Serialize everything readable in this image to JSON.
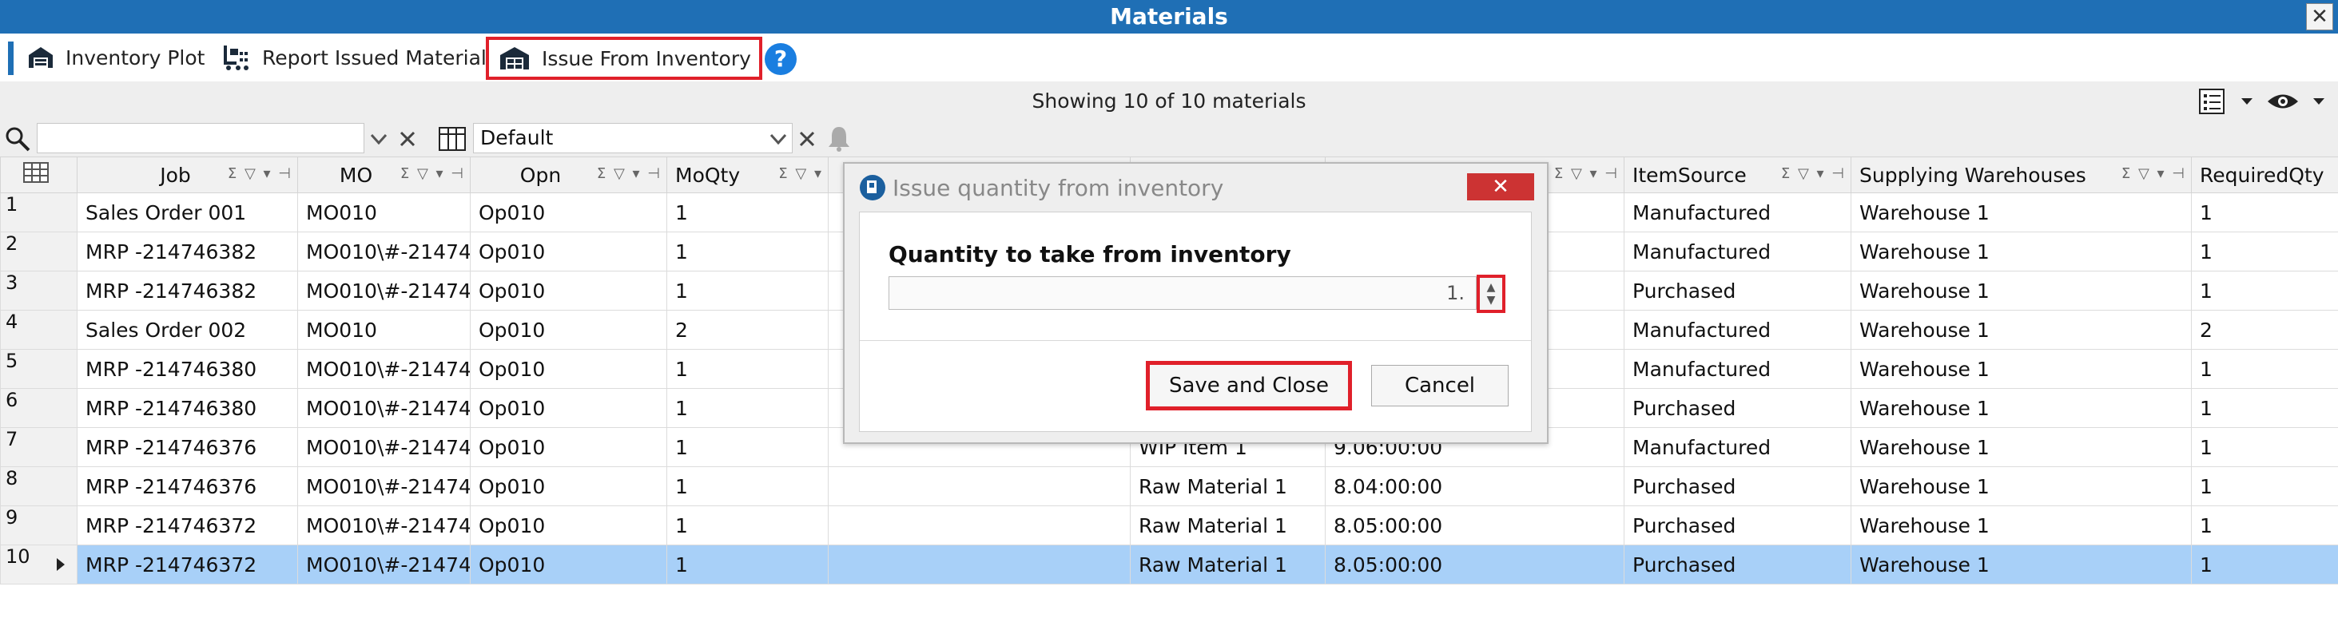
{
  "window": {
    "title": "Materials",
    "close_glyph": "✕"
  },
  "toolbar": {
    "inventory_plot_label": "Inventory Plot",
    "report_issued_label": "Report Issued Material",
    "issue_from_inventory_label": "Issue From Inventory",
    "help_glyph": "?"
  },
  "status": {
    "showing_text": "Showing 10 of 10 materials"
  },
  "filter": {
    "search_value": "",
    "layout_value": "Default"
  },
  "grid": {
    "columns": [
      "Job",
      "MO",
      "Opn",
      "MoQty",
      "",
      "",
      "",
      "ItemSource",
      "Supplying Warehouses",
      "RequiredQty"
    ],
    "rows": [
      {
        "num": "1",
        "job": "Sales Order 001",
        "mo": "MO010",
        "opn": "Op010",
        "moqty": "1",
        "c5": "",
        "c6": "",
        "c7": "",
        "source": "Manufactured",
        "warehouse": "Warehouse 1",
        "req": "1"
      },
      {
        "num": "2",
        "job": "MRP -214746382",
        "mo": "MO010\\#-21474",
        "opn": "Op010",
        "moqty": "1",
        "c5": "",
        "c6": "",
        "c7": "",
        "source": "Manufactured",
        "warehouse": "Warehouse 1",
        "req": "1"
      },
      {
        "num": "3",
        "job": "MRP -214746382",
        "mo": "MO010\\#-21474",
        "opn": "Op010",
        "moqty": "1",
        "c5": "",
        "c6": "",
        "c7": "",
        "source": "Purchased",
        "warehouse": "Warehouse 1",
        "req": "1"
      },
      {
        "num": "4",
        "job": "Sales Order 002",
        "mo": "MO010",
        "opn": "Op010",
        "moqty": "2",
        "c5": "",
        "c6": "",
        "c7": "",
        "source": "Manufactured",
        "warehouse": "Warehouse 1",
        "req": "2"
      },
      {
        "num": "5",
        "job": "MRP -214746380",
        "mo": "MO010\\#-21474",
        "opn": "Op010",
        "moqty": "1",
        "c5": "",
        "c6": "",
        "c7": "",
        "source": "Manufactured",
        "warehouse": "Warehouse 1",
        "req": "1"
      },
      {
        "num": "6",
        "job": "MRP -214746380",
        "mo": "MO010\\#-21474",
        "opn": "Op010",
        "moqty": "1",
        "c5": "",
        "c6": "",
        "c7": "",
        "source": "Purchased",
        "warehouse": "Warehouse 1",
        "req": "1"
      },
      {
        "num": "7",
        "job": "MRP -214746376",
        "mo": "MO010\\#-21474",
        "opn": "Op010",
        "moqty": "1",
        "c5": "",
        "c6": "WIP Item 1",
        "c7": "9.06:00:00",
        "source": "Manufactured",
        "warehouse": "Warehouse 1",
        "req": "1"
      },
      {
        "num": "8",
        "job": "MRP -214746376",
        "mo": "MO010\\#-21474",
        "opn": "Op010",
        "moqty": "1",
        "c5": "",
        "c6": "Raw Material 1",
        "c7": "8.04:00:00",
        "source": "Purchased",
        "warehouse": "Warehouse 1",
        "req": "1"
      },
      {
        "num": "9",
        "job": "MRP -214746372",
        "mo": "MO010\\#-21474",
        "opn": "Op010",
        "moqty": "1",
        "c5": "",
        "c6": "Raw Material 1",
        "c7": "8.05:00:00",
        "source": "Purchased",
        "warehouse": "Warehouse 1",
        "req": "1"
      },
      {
        "num": "10",
        "job": "MRP -214746372",
        "mo": "MO010\\#-21474",
        "opn": "Op010",
        "moqty": "1",
        "c5": "",
        "c6": "Raw Material 1",
        "c7": "8.05:00:00",
        "source": "Purchased",
        "warehouse": "Warehouse 1",
        "req": "1"
      }
    ],
    "selected_row": "10"
  },
  "dialog": {
    "title": "Issue quantity from inventory",
    "close_glyph": "✕",
    "quantity_label": "Quantity to take from inventory",
    "quantity_value": "1.",
    "save_label": "Save and Close",
    "cancel_label": "Cancel"
  },
  "colors": {
    "title_bar": "#1f6fb5",
    "selected_row": "#a8d0f8",
    "highlight_border": "#e0202a",
    "dialog_close": "#cc3333"
  }
}
